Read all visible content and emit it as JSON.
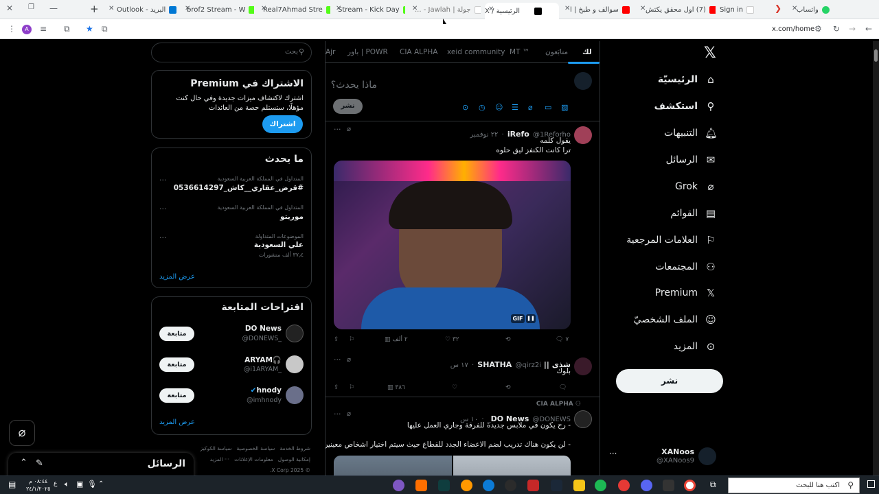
{
  "browser": {
    "tabs": [
      {
        "label": "واتساب",
        "color": "#25d366"
      },
      {
        "label": "Sign in",
        "color": "#ffffff"
      },
      {
        "label": "(7) اول محقق يكتش",
        "color": "#ff0000"
      },
      {
        "label": "سوالف و طبخ | ا",
        "color": "#ff0000"
      },
      {
        "label": "الرئيسية / X",
        "color": "#000000"
      },
      {
        "label": "جولة | Jawlah - ...",
        "color": "#ffffff"
      },
      {
        "label": "Stream - Kick Day",
        "color": "#53fc18"
      },
      {
        "label": "Real7Ahmad Stre",
        "color": "#53fc18"
      },
      {
        "label": "brof2 Stream - W",
        "color": "#53fc18"
      },
      {
        "label": "البريد - Outlook",
        "color": "#0078d4"
      }
    ],
    "url": "x.com/home"
  },
  "nav": {
    "items": [
      {
        "label": "الرئيسيّة",
        "icon": "home-icon"
      },
      {
        "label": "استكشف",
        "icon": "search-icon"
      },
      {
        "label": "التنبيهات",
        "icon": "bell-icon"
      },
      {
        "label": "الرسائل",
        "icon": "mail-icon"
      },
      {
        "label": "Grok",
        "icon": "grok-icon"
      },
      {
        "label": "القوائم",
        "icon": "list-icon"
      },
      {
        "label": "العلامات المرجعية",
        "icon": "bookmark-icon"
      },
      {
        "label": "المجتمعات",
        "icon": "communities-icon"
      },
      {
        "label": "Premium",
        "icon": "x-icon"
      },
      {
        "label": "الملف الشخصيّ",
        "icon": "profile-icon"
      },
      {
        "label": "المزيد",
        "icon": "more-icon"
      }
    ],
    "post_label": "نشر",
    "account": {
      "name": "XANoos",
      "handle": "@XANoos9"
    }
  },
  "feed": {
    "tabs": [
      "لك",
      "متابَعون",
      "MT ™",
      "xeid community",
      "CIA ALPHA",
      "باور | POWR",
      "Ajr"
    ],
    "compose_placeholder": "ماذا يحدث؟",
    "publish_label": "نشر",
    "tweets": [
      {
        "name": "iRefo",
        "handle": "@1Reforho",
        "time": "٢٢ نوفمبر",
        "lines": [
          "يقول كلمه",
          "ترا كانت الكنفز ليق حلوه"
        ],
        "gif_label": "GIF",
        "replies": "٧",
        "likes": "٣٢",
        "views": "٢ ألف"
      },
      {
        "name": "شذى || SHATHA",
        "handle": "@qirz2i",
        "time": "١٧ س",
        "lines": [
          "بلوك"
        ],
        "views": "٣٨٦"
      },
      {
        "community": "CIA ALPHA",
        "name": "DO News",
        "handle": "@DONEWS_",
        "time": "١٠ س",
        "lines": [
          "- رح يكون في ملابس جديدة للفرقة وجاري العمل عليها",
          "- لن يكون هناك تدريب لضم الاعضاء الجدد للقطاع حيث سيتم اختيار اشخاص معينين"
        ]
      }
    ]
  },
  "sidebar": {
    "search_placeholder": "بحث",
    "premium": {
      "title": "الاشتراك في Premium",
      "text": "اشترك لاكتشاف ميزات جديدة وفي حال كنت مؤهلًا، ستستلم حصة من العائدات",
      "button": "اشتراك"
    },
    "trends": {
      "title": "ما يحدث",
      "items": [
        {
          "context": "المتداول في المملكة العربية السعودية",
          "topic": "#قرض_عقاري__كاش_0536614297",
          "count": ""
        },
        {
          "context": "المتداول في المملكة العربية السعودية",
          "topic": "موريتو",
          "count": ""
        },
        {
          "context": "الموضوعات المتداولة",
          "topic": "علي السعودية",
          "count": "٣٧٫٤ ألف منشورات"
        }
      ],
      "more": "عرض المزيد"
    },
    "follow": {
      "title": "اقتراحات المتابعة",
      "items": [
        {
          "name": "DO News",
          "handle": "@DONEWS_",
          "button": "متابعة"
        },
        {
          "name": "ARYAM🎧",
          "handle": "@i1ARYAM_",
          "button": "متابعة"
        },
        {
          "name": "hnody",
          "handle": "@imhnody",
          "button": "متابعة"
        }
      ],
      "more": "عرض المزيد"
    },
    "footer": [
      "شروط الخدمة",
      "سياسة الخصوصية",
      "سياسة الكوكيز",
      "إمكانية الوصول",
      "معلومات الإعلانات",
      "··· المزيد",
      "© 2025 X Corp."
    ]
  },
  "messages_dock": {
    "title": "الرسائل"
  },
  "taskbar": {
    "search_placeholder": "اكتب هنا للبحث",
    "time": "٠٨:٤٤ م",
    "date": "٢٤/١/٢٠٢٥",
    "lang": "ع"
  }
}
